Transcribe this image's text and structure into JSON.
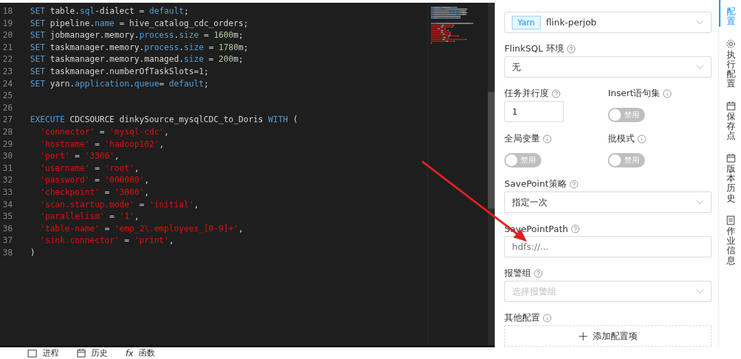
{
  "editor": {
    "lines": [
      {
        "no": "18",
        "tokens": [
          {
            "t": "SET",
            "color": "#569cd6"
          },
          {
            "t": " table."
          },
          {
            "t": "sql",
            "color": "#569cd6"
          },
          {
            "t": "-dialect = "
          },
          {
            "t": "default",
            "color": "#569cd6"
          },
          {
            "t": ";"
          }
        ]
      },
      {
        "no": "19",
        "tokens": [
          {
            "t": "SET",
            "color": "#569cd6"
          },
          {
            "t": " pipeline."
          },
          {
            "t": "name",
            "color": "#569cd6"
          },
          {
            "t": " = hive_catalog_cdc_orders;"
          }
        ]
      },
      {
        "no": "20",
        "tokens": [
          {
            "t": "SET",
            "color": "#569cd6"
          },
          {
            "t": " jobmanager.memory."
          },
          {
            "t": "process",
            "color": "#569cd6"
          },
          {
            "t": "."
          },
          {
            "t": "size",
            "color": "#569cd6"
          },
          {
            "t": " = "
          },
          {
            "t": "1600",
            "color": "#b5cea8"
          },
          {
            "t": "m;"
          }
        ]
      },
      {
        "no": "21",
        "tokens": [
          {
            "t": "SET",
            "color": "#569cd6"
          },
          {
            "t": " taskmanager.memory."
          },
          {
            "t": "process",
            "color": "#569cd6"
          },
          {
            "t": "."
          },
          {
            "t": "size",
            "color": "#569cd6"
          },
          {
            "t": " = "
          },
          {
            "t": "1780",
            "color": "#b5cea8"
          },
          {
            "t": "m;"
          }
        ]
      },
      {
        "no": "22",
        "tokens": [
          {
            "t": "SET",
            "color": "#569cd6"
          },
          {
            "t": " taskmanager.memory.managed."
          },
          {
            "t": "size",
            "color": "#569cd6"
          },
          {
            "t": " = "
          },
          {
            "t": "200",
            "color": "#b5cea8"
          },
          {
            "t": "m;"
          }
        ]
      },
      {
        "no": "23",
        "tokens": [
          {
            "t": "SET",
            "color": "#569cd6"
          },
          {
            "t": " taskmanager.numberOfTaskSlots="
          },
          {
            "t": "1",
            "color": "#b5cea8"
          },
          {
            "t": ";"
          }
        ]
      },
      {
        "no": "24",
        "tokens": [
          {
            "t": "SET",
            "color": "#569cd6"
          },
          {
            "t": " yarn."
          },
          {
            "t": "application",
            "color": "#569cd6"
          },
          {
            "t": "."
          },
          {
            "t": "queue",
            "color": "#569cd6"
          },
          {
            "t": "= "
          },
          {
            "t": "default",
            "color": "#569cd6"
          },
          {
            "t": ";"
          }
        ]
      },
      {
        "no": "25"
      },
      {
        "no": "26"
      },
      {
        "no": "27",
        "tokens": [
          {
            "t": "EXECUTE",
            "color": "#569cd6"
          },
          {
            "t": " CDCSOURCE dinkySource_mysqlCDC_to_Doris "
          },
          {
            "t": "WITH",
            "color": "#569cd6"
          },
          {
            "t": " ("
          }
        ]
      },
      {
        "no": "28",
        "tokens": [
          {
            "t": "  'connector'",
            "color": "#e01010"
          },
          {
            "t": " = "
          },
          {
            "t": "'mysql-cdc'",
            "color": "#e01010"
          },
          {
            "t": ","
          }
        ]
      },
      {
        "no": "29",
        "tokens": [
          {
            "t": "  'hostname'",
            "color": "#e01010"
          },
          {
            "t": " = "
          },
          {
            "t": "'hadoop102'",
            "color": "#e01010"
          },
          {
            "t": ","
          }
        ]
      },
      {
        "no": "30",
        "tokens": [
          {
            "t": "  'port'",
            "color": "#e01010"
          },
          {
            "t": " = "
          },
          {
            "t": "'3306'",
            "color": "#e01010"
          },
          {
            "t": ","
          }
        ]
      },
      {
        "no": "31",
        "tokens": [
          {
            "t": "  'username'",
            "color": "#e01010"
          },
          {
            "t": " = "
          },
          {
            "t": "'root'",
            "color": "#e01010"
          },
          {
            "t": ","
          }
        ]
      },
      {
        "no": "32",
        "tokens": [
          {
            "t": "  'password'",
            "color": "#e01010"
          },
          {
            "t": " = "
          },
          {
            "t": "'000000'",
            "color": "#e01010"
          },
          {
            "t": ","
          }
        ]
      },
      {
        "no": "33",
        "tokens": [
          {
            "t": "  'checkpoint'",
            "color": "#e01010"
          },
          {
            "t": " = "
          },
          {
            "t": "'3000'",
            "color": "#e01010"
          },
          {
            "t": ","
          }
        ]
      },
      {
        "no": "34",
        "tokens": [
          {
            "t": "  'scan.startup.mode'",
            "color": "#e01010"
          },
          {
            "t": " = "
          },
          {
            "t": "'initial'",
            "color": "#e01010"
          },
          {
            "t": ","
          }
        ]
      },
      {
        "no": "35",
        "tokens": [
          {
            "t": "  'parallelism'",
            "color": "#e01010"
          },
          {
            "t": " = "
          },
          {
            "t": "'1'",
            "color": "#e01010"
          },
          {
            "t": ","
          }
        ]
      },
      {
        "no": "36",
        "tokens": [
          {
            "t": "  'table-name'",
            "color": "#e01010"
          },
          {
            "t": " = "
          },
          {
            "t": "'emp_2\\.employees_[0-9]+'",
            "color": "#e01010"
          },
          {
            "t": ","
          }
        ]
      },
      {
        "no": "37",
        "tokens": [
          {
            "t": "  'sink.connector'",
            "color": "#e01010"
          },
          {
            "t": " = "
          },
          {
            "t": "'print'",
            "color": "#e01010"
          },
          {
            "t": ","
          }
        ]
      },
      {
        "no": "38",
        "tokens": [
          {
            "t": ")"
          }
        ]
      }
    ]
  },
  "config": {
    "fields": [
      {
        "kind": "select",
        "tag": "Yarn",
        "value": "flink-perjob"
      },
      {
        "kind": "select",
        "label": "FlinkSQL 环境",
        "help": {
          "kind": "question"
        },
        "value": "无"
      },
      {
        "kind": "pair",
        "items": [
          {
            "kind": "input",
            "label": "任务并行度",
            "help": {
              "kind": "question"
            },
            "value": "1"
          },
          {
            "kind": "switch",
            "label": "Insert语句集",
            "help": {
              "kind": "info"
            },
            "on": false,
            "text": "禁用"
          }
        ]
      },
      {
        "kind": "pair",
        "items": [
          {
            "kind": "switch",
            "label": "全局变量",
            "help": {
              "kind": "info"
            },
            "on": false,
            "text": "禁用"
          },
          {
            "kind": "switch",
            "label": "批模式",
            "help": {
              "kind": "info"
            },
            "on": false,
            "text": "禁用"
          }
        ]
      },
      {
        "kind": "select",
        "label": "SavePoint策略",
        "help": {
          "kind": "question"
        },
        "value": "指定一次"
      },
      {
        "kind": "input",
        "label": "SavePointPath",
        "help": {
          "kind": "question"
        },
        "placeholder": "hdfs://..."
      },
      {
        "kind": "select",
        "label": "报警组",
        "help": {
          "kind": "question"
        },
        "placeholder": "选择报警组"
      },
      {
        "kind": "add",
        "label": "其他配置",
        "help": {
          "kind": "info"
        },
        "button": "添加配置项"
      }
    ]
  },
  "side_tabs": [
    {
      "label": "配置",
      "selected": true
    },
    {
      "label": "执行配置",
      "selected": false
    },
    {
      "label": "保存点",
      "selected": false
    },
    {
      "label": "版本历史",
      "selected": false
    },
    {
      "label": "作业信息",
      "selected": false
    }
  ],
  "bottom_tabs": [
    {
      "label": "进程"
    },
    {
      "label": "历史"
    },
    {
      "label": "函数",
      "glyph": "fx"
    }
  ]
}
